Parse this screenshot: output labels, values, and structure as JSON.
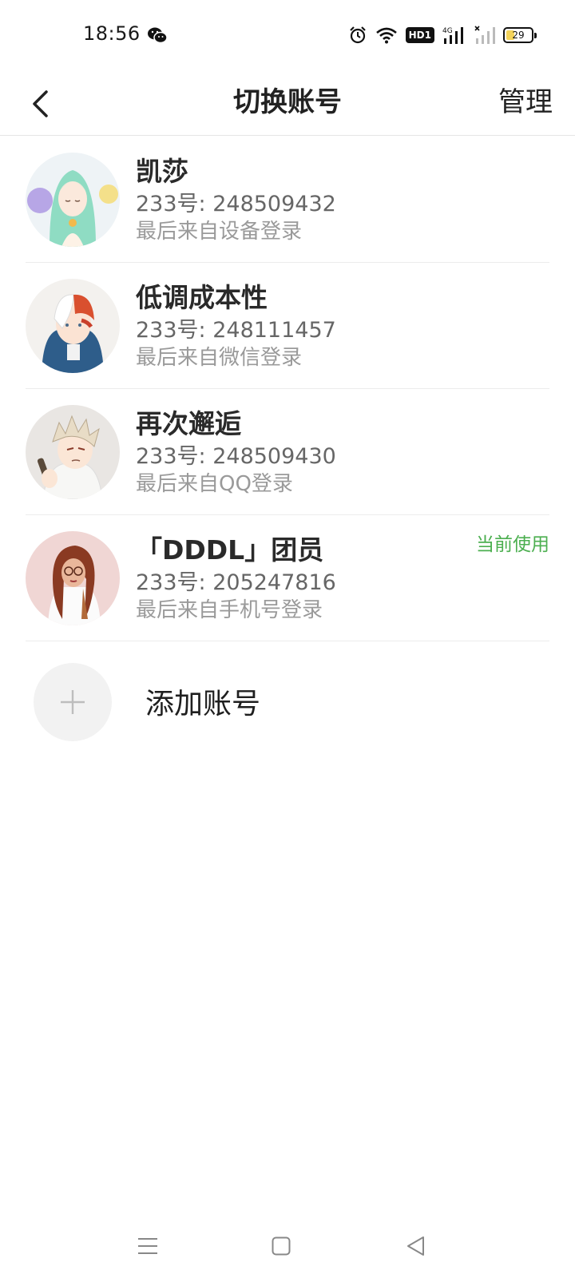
{
  "status_bar": {
    "time": "18:56",
    "network_badge": "HD1",
    "network_type": "4G",
    "battery_level": "29",
    "icons": [
      "wechat-icon",
      "alarm-icon",
      "wifi-icon",
      "signal-icon",
      "signal-x-icon",
      "battery-icon"
    ]
  },
  "header": {
    "title": "切换账号",
    "manage_label": "管理",
    "back_icon": "chevron-left-icon"
  },
  "accounts": [
    {
      "name": "凯莎",
      "id_text": "233号: 248509432",
      "login_text": "最后来自设备登录",
      "current_label": ""
    },
    {
      "name": "低调成本性",
      "id_text": "233号: 248111457",
      "login_text": "最后来自微信登录",
      "current_label": ""
    },
    {
      "name": "再次邂逅",
      "id_text": "233号: 248509430",
      "login_text": "最后来自QQ登录",
      "current_label": ""
    },
    {
      "name": "「DDDL」团员",
      "id_text": "233号: 205247816",
      "login_text": "最后来自手机号登录",
      "current_label": "当前使用"
    }
  ],
  "add_account": {
    "label": "添加账号",
    "icon": "plus-icon"
  },
  "nav_bar": {
    "icons": [
      "menu-icon",
      "home-square-icon",
      "back-triangle-icon"
    ]
  },
  "colors": {
    "accent_green": "#4caf50",
    "text_primary": "#222222",
    "text_secondary": "#666666",
    "text_tertiary": "#9a9a9a",
    "divider": "#ececec"
  }
}
